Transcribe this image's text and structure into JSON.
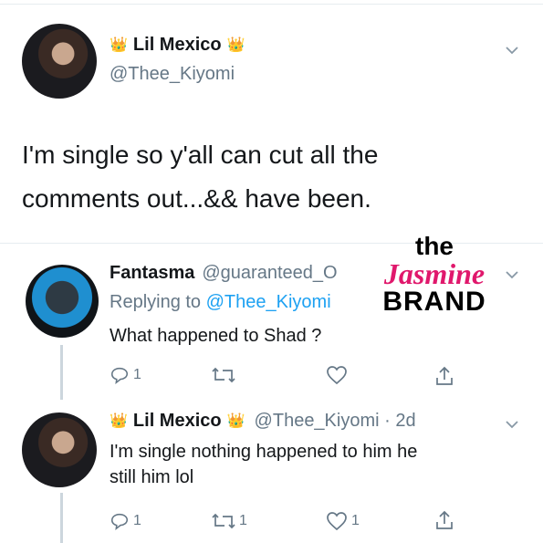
{
  "main_tweet": {
    "display_name": "Lil Mexico",
    "handle": "@Thee_Kiyomi",
    "text_line1": "I'm single so y'all can cut all the",
    "text_line2": "comments out...&& have been."
  },
  "reply1": {
    "display_name": "Fantasma",
    "handle": "@guaranteed_O",
    "replying_prefix": "Replying to ",
    "replying_to": "@Thee_Kiyomi",
    "text": "What happened to Shad ?",
    "reply_count": "1",
    "retweet_count": "",
    "like_count": ""
  },
  "reply2": {
    "display_name": "Lil Mexico",
    "handle_time": "@Thee_Kiyomi · 2d",
    "text_line1": "I'm single nothing happened to him he",
    "text_line2": "still him lol",
    "reply_count": "1",
    "retweet_count": "1",
    "like_count": "1"
  },
  "watermark": {
    "line1": "the",
    "line2": "Jasmine",
    "line3": "BRAND"
  },
  "icons": {
    "crown": "crown-icon",
    "chevron": "chevron-down-icon",
    "reply": "reply-icon",
    "retweet": "retweet-icon",
    "like": "heart-icon",
    "share": "share-icon"
  },
  "colors": {
    "text": "#14171a",
    "secondary": "#657786",
    "link": "#1da1f2",
    "watermark_pink": "#e0186c"
  }
}
